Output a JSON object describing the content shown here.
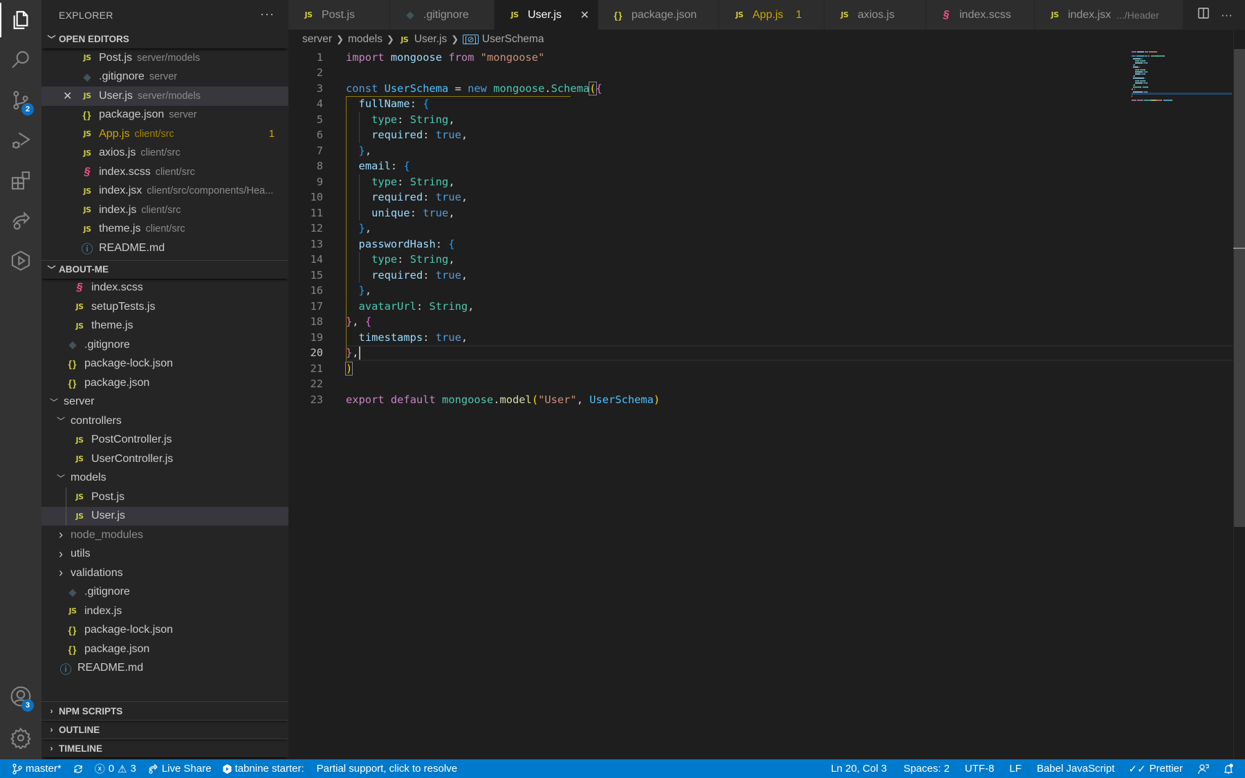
{
  "activity_bar": {
    "items": [
      {
        "name": "explorer",
        "icon": "files-icon",
        "active": true
      },
      {
        "name": "search",
        "icon": "search-icon"
      },
      {
        "name": "source-control",
        "icon": "source-control-icon",
        "badge": "2"
      },
      {
        "name": "run-debug",
        "icon": "run-debug-icon"
      },
      {
        "name": "extensions",
        "icon": "extensions-icon"
      },
      {
        "name": "live-share",
        "icon": "live-share-icon"
      },
      {
        "name": "tabnine",
        "icon": "tabnine-icon"
      }
    ],
    "accounts_badge": "3",
    "accounts_icon": "account-icon",
    "settings_icon": "gear-icon"
  },
  "sidebar": {
    "title": "EXPLORER",
    "more": "···",
    "open_editors": {
      "title": "OPEN EDITORS",
      "items": [
        {
          "name": "Post.js",
          "desc": "server/models",
          "icon": "js"
        },
        {
          "name": ".gitignore",
          "desc": "server",
          "icon": "git"
        },
        {
          "name": "User.js",
          "desc": "server/models",
          "icon": "js",
          "selected": true
        },
        {
          "name": "package.json",
          "desc": "server",
          "icon": "json"
        },
        {
          "name": "App.js",
          "desc": "client/src",
          "icon": "js",
          "problems": "1"
        },
        {
          "name": "axios.js",
          "desc": "client/src",
          "icon": "js"
        },
        {
          "name": "index.scss",
          "desc": "client/src",
          "icon": "scss"
        },
        {
          "name": "index.jsx",
          "desc": "client/src/components/Hea...",
          "icon": "js"
        },
        {
          "name": "index.js",
          "desc": "client/src",
          "icon": "js"
        },
        {
          "name": "theme.js",
          "desc": "client/src",
          "icon": "js"
        },
        {
          "name": "README.md",
          "desc": "",
          "icon": "info"
        }
      ]
    },
    "project": {
      "title": "ABOUT-ME",
      "tree": [
        {
          "name": "index.scss",
          "icon": "scss",
          "depth": 3
        },
        {
          "name": "setupTests.js",
          "icon": "js",
          "depth": 3
        },
        {
          "name": "theme.js",
          "icon": "js",
          "depth": 3
        },
        {
          "name": ".gitignore",
          "icon": "git",
          "depth": 2
        },
        {
          "name": "package-lock.json",
          "icon": "json",
          "depth": 2
        },
        {
          "name": "package.json",
          "icon": "json",
          "depth": 2
        },
        {
          "name": "server",
          "folder": "open",
          "depth": 1
        },
        {
          "name": "controllers",
          "folder": "open",
          "depth": 2
        },
        {
          "name": "PostController.js",
          "icon": "js",
          "depth": 3
        },
        {
          "name": "UserController.js",
          "icon": "js",
          "depth": 3
        },
        {
          "name": "models",
          "folder": "open",
          "depth": 2
        },
        {
          "name": "Post.js",
          "icon": "js",
          "depth": 3
        },
        {
          "name": "User.js",
          "icon": "js",
          "depth": 3,
          "selected": true
        },
        {
          "name": "node_modules",
          "folder": "closed",
          "depth": 2,
          "dim": true
        },
        {
          "name": "utils",
          "folder": "closed",
          "depth": 2
        },
        {
          "name": "validations",
          "folder": "closed",
          "depth": 2
        },
        {
          "name": ".gitignore",
          "icon": "git",
          "depth": 2
        },
        {
          "name": "index.js",
          "icon": "js",
          "depth": 2
        },
        {
          "name": "package-lock.json",
          "icon": "json",
          "depth": 2
        },
        {
          "name": "package.json",
          "icon": "json",
          "depth": 2
        },
        {
          "name": "README.md",
          "icon": "info",
          "depth": 1
        }
      ]
    },
    "collapsed_sections": [
      "NPM SCRIPTS",
      "OUTLINE",
      "TIMELINE"
    ]
  },
  "tabs": [
    {
      "label": "Post.js",
      "icon": "js"
    },
    {
      "label": ".gitignore",
      "icon": "git"
    },
    {
      "label": "User.js",
      "icon": "js",
      "active": true
    },
    {
      "label": "package.json",
      "icon": "json"
    },
    {
      "label": "App.js",
      "icon": "js",
      "count": "1",
      "warning": true
    },
    {
      "label": "axios.js",
      "icon": "js"
    },
    {
      "label": "index.scss",
      "icon": "scss"
    },
    {
      "label": "index.jsx",
      "icon": "js",
      "desc": ".../Header"
    }
  ],
  "tab_actions": {
    "split": "split-editor-icon",
    "more": "···"
  },
  "breadcrumb": [
    "server",
    "models",
    "User.js",
    "UserSchema"
  ],
  "editor": {
    "current_line": 20,
    "lines": [
      [
        [
          "k",
          "import"
        ],
        [
          "p",
          " "
        ],
        [
          "v",
          "mongoose"
        ],
        [
          "p",
          " "
        ],
        [
          "k",
          "from"
        ],
        [
          "p",
          " "
        ],
        [
          "s",
          "\"mongoose\""
        ]
      ],
      [],
      [
        [
          "kb",
          "const"
        ],
        [
          "p",
          " "
        ],
        [
          "c",
          "UserSchema"
        ],
        [
          "p",
          " = "
        ],
        [
          "kb",
          "new"
        ],
        [
          "p",
          " "
        ],
        [
          "t",
          "mongoose"
        ],
        [
          "p",
          "."
        ],
        [
          "t",
          "Schema"
        ],
        [
          "b1box",
          "("
        ],
        [
          "b2",
          "{"
        ]
      ],
      [
        [
          "p",
          "  "
        ],
        [
          "v",
          "fullName"
        ],
        [
          "p",
          ": "
        ],
        [
          "b3",
          "{"
        ]
      ],
      [
        [
          "p",
          "    "
        ],
        [
          "t",
          "type"
        ],
        [
          "p",
          ": "
        ],
        [
          "t",
          "String"
        ],
        [
          "p",
          ","
        ]
      ],
      [
        [
          "p",
          "    "
        ],
        [
          "v",
          "required"
        ],
        [
          "p",
          ": "
        ],
        [
          "kb",
          "true"
        ],
        [
          "p",
          ","
        ]
      ],
      [
        [
          "p",
          "  "
        ],
        [
          "b3",
          "}"
        ],
        [
          "p",
          ","
        ]
      ],
      [
        [
          "p",
          "  "
        ],
        [
          "v",
          "email"
        ],
        [
          "p",
          ": "
        ],
        [
          "b3",
          "{"
        ]
      ],
      [
        [
          "p",
          "    "
        ],
        [
          "t",
          "type"
        ],
        [
          "p",
          ": "
        ],
        [
          "t",
          "String"
        ],
        [
          "p",
          ","
        ]
      ],
      [
        [
          "p",
          "    "
        ],
        [
          "v",
          "required"
        ],
        [
          "p",
          ": "
        ],
        [
          "kb",
          "true"
        ],
        [
          "p",
          ","
        ]
      ],
      [
        [
          "p",
          "    "
        ],
        [
          "v",
          "unique"
        ],
        [
          "p",
          ": "
        ],
        [
          "kb",
          "true"
        ],
        [
          "p",
          ","
        ]
      ],
      [
        [
          "p",
          "  "
        ],
        [
          "b3",
          "}"
        ],
        [
          "p",
          ","
        ]
      ],
      [
        [
          "p",
          "  "
        ],
        [
          "v",
          "passwordHash"
        ],
        [
          "p",
          ": "
        ],
        [
          "b3",
          "{"
        ]
      ],
      [
        [
          "p",
          "    "
        ],
        [
          "t",
          "type"
        ],
        [
          "p",
          ": "
        ],
        [
          "t",
          "String"
        ],
        [
          "p",
          ","
        ]
      ],
      [
        [
          "p",
          "    "
        ],
        [
          "v",
          "required"
        ],
        [
          "p",
          ": "
        ],
        [
          "kb",
          "true"
        ],
        [
          "p",
          ","
        ]
      ],
      [
        [
          "p",
          "  "
        ],
        [
          "b3",
          "}"
        ],
        [
          "p",
          ","
        ]
      ],
      [
        [
          "p",
          "  "
        ],
        [
          "t",
          "avatarUrl"
        ],
        [
          "p",
          ": "
        ],
        [
          "t",
          "String"
        ],
        [
          "p",
          ","
        ]
      ],
      [
        [
          "b2",
          "}"
        ],
        [
          "p",
          ", "
        ],
        [
          "b2",
          "{"
        ]
      ],
      [
        [
          "p",
          "  "
        ],
        [
          "v",
          "timestamps"
        ],
        [
          "p",
          ": "
        ],
        [
          "kb",
          "true"
        ],
        [
          "p",
          ","
        ]
      ],
      [
        [
          "b2",
          "}"
        ],
        [
          "p",
          ","
        ],
        [
          "cursor",
          ""
        ]
      ],
      [
        [
          "b1box",
          ")"
        ]
      ],
      [],
      [
        [
          "k",
          "export"
        ],
        [
          "p",
          " "
        ],
        [
          "k",
          "default"
        ],
        [
          "p",
          " "
        ],
        [
          "t",
          "mongoose"
        ],
        [
          "p",
          "."
        ],
        [
          "f",
          "model"
        ],
        [
          "b1",
          "("
        ],
        [
          "s",
          "\"User\""
        ],
        [
          "p",
          ", "
        ],
        [
          "c",
          "UserSchema"
        ],
        [
          "b1",
          ")"
        ]
      ]
    ]
  },
  "status_bar": {
    "branch": "master*",
    "sync_icon": "sync-icon",
    "errors": "0",
    "warnings": "3",
    "live_share": "Live Share",
    "tabnine": "tabnine starter:",
    "tabnine_msg": "Partial support, click to resolve",
    "position": "Ln 20, Col 3",
    "indent": "Spaces: 2",
    "encoding": "UTF-8",
    "eol": "LF",
    "language": "Babel JavaScript",
    "formatter": "Prettier",
    "feedback_icon": "feedback-icon",
    "notifications_icon": "bell-icon"
  },
  "colors": {
    "accent": "#007acc",
    "badge": "#0e70c0",
    "warning": "#cca700",
    "js_icon": "#cbcb41",
    "scss_icon": "#f55385"
  }
}
